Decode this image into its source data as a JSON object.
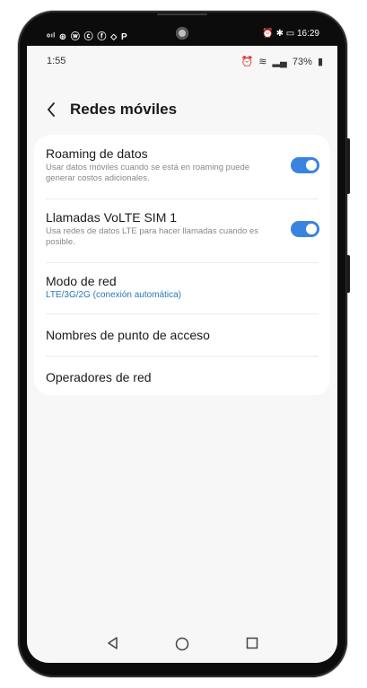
{
  "outer_status": {
    "left_icons": "ᵒᶦˡ ⊕ ⓦ ⓒ ⓕ ⬦ P",
    "right_text": "⏰ ✱ ▭ 16:29"
  },
  "status_bar": {
    "time": "1:55",
    "alarm_icon": "⏰",
    "wifi_icon": "≋",
    "signal_icon": "▂▄",
    "battery": "73%",
    "battery_icon": "▮"
  },
  "header": {
    "title": "Redes móviles",
    "back_icon": "chevron-left-icon"
  },
  "settings": {
    "roaming": {
      "title": "Roaming de datos",
      "desc": "Usar datos móviles cuando se está en roaming puede generar costos adicionales.",
      "enabled": true
    },
    "volte": {
      "title": "Llamadas VoLTE SIM 1",
      "desc": "Usa redes de datos LTE para hacer llamadas cuando es posible.",
      "enabled": true
    },
    "network_mode": {
      "title": "Modo de red",
      "value": "LTE/3G/2G (conexión automática)"
    },
    "apn": {
      "title": "Nombres de punto de acceso"
    },
    "operators": {
      "title": "Operadores de red"
    }
  },
  "nav": {
    "back": "triangle-back-icon",
    "home": "circle-home-icon",
    "recents": "square-recents-icon"
  },
  "colors": {
    "accent": "#3a84e0",
    "value_text": "#2a78b8",
    "background": "#f7f7f7",
    "card": "#ffffff"
  }
}
